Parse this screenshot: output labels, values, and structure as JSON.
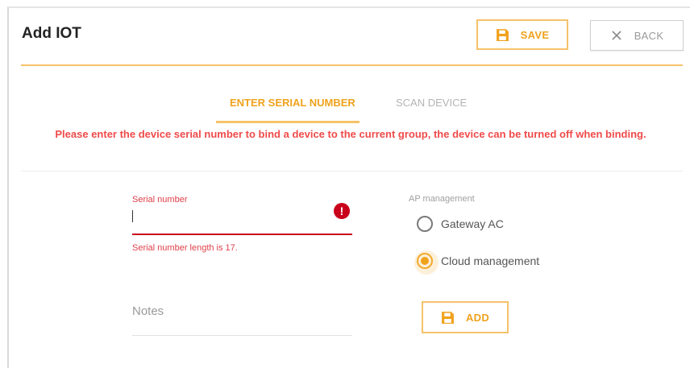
{
  "header": {
    "title": "Add IOT",
    "save_label": "SAVE",
    "back_label": "BACK"
  },
  "tabs": [
    {
      "label": "ENTER SERIAL NUMBER",
      "active": true
    },
    {
      "label": "SCAN DEVICE",
      "active": false
    }
  ],
  "notice": "Please enter the device serial number to bind a device to the current group, the device can be turned off when binding.",
  "form": {
    "serial_label": "Serial number",
    "serial_value": "",
    "serial_error": "Serial number length is 17.",
    "notes_placeholder": "Notes",
    "ap_label": "AP management",
    "ap_options": [
      {
        "label": "Gateway AC",
        "selected": false
      },
      {
        "label": "Cloud management",
        "selected": true
      }
    ],
    "add_label": "ADD"
  },
  "colors": {
    "accent": "#f0a21d",
    "accent_border": "#f6c26a",
    "error": "#c9001b",
    "notice": "#f04a4a"
  },
  "icons": [
    "save-icon",
    "close-icon",
    "error-icon"
  ]
}
